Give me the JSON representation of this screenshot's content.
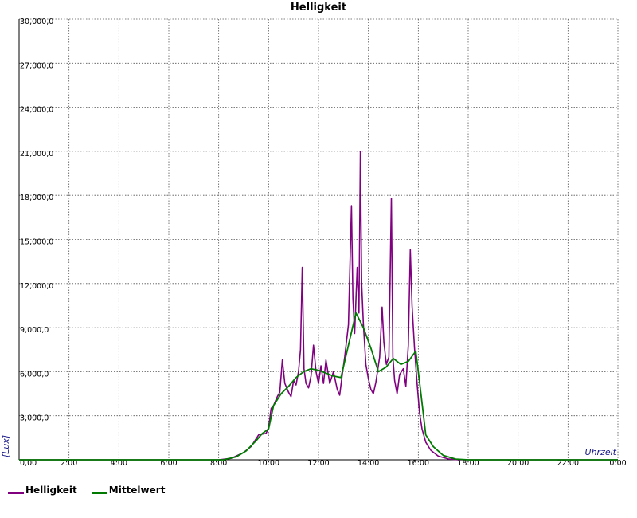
{
  "chart_data": {
    "type": "line",
    "title": "Helligkeit",
    "xlabel": "Uhrzeit",
    "ylabel": "[Lux]",
    "xlim": [
      0,
      24
    ],
    "ylim": [
      0,
      30000
    ],
    "x_ticks": [
      0,
      2,
      4,
      6,
      8,
      10,
      12,
      14,
      16,
      18,
      20,
      22,
      24
    ],
    "x_tick_labels": [
      "0,00",
      "2:00",
      "4:00",
      "6:00",
      "8:00",
      "10:00",
      "12:00",
      "14:00",
      "16:00",
      "18:00",
      "20:00",
      "22:00",
      "0:00"
    ],
    "y_ticks": [
      0,
      3000,
      6000,
      9000,
      12000,
      15000,
      18000,
      21000,
      24000,
      27000,
      30000
    ],
    "y_tick_labels": [
      "",
      "3,000,0",
      "6,000,0",
      "9,000,0",
      "12,000,0",
      "15,000,0",
      "18,000,0",
      "21,000,0",
      "24,000,0",
      "27,000,0",
      "30,000,0"
    ],
    "grid": true,
    "legend_position": "bottom-left",
    "series": [
      {
        "name": "Helligkeit",
        "color": "#800080",
        "points": [
          [
            0,
            0
          ],
          [
            8.0,
            0
          ],
          [
            8.5,
            100
          ],
          [
            9.0,
            500
          ],
          [
            9.3,
            900
          ],
          [
            9.6,
            1700
          ],
          [
            9.9,
            1800
          ],
          [
            10.0,
            2200
          ],
          [
            10.1,
            3500
          ],
          [
            10.2,
            3700
          ],
          [
            10.35,
            4300
          ],
          [
            10.45,
            4600
          ],
          [
            10.55,
            6800
          ],
          [
            10.65,
            5200
          ],
          [
            10.8,
            4600
          ],
          [
            10.9,
            4300
          ],
          [
            11.0,
            5400
          ],
          [
            11.1,
            5100
          ],
          [
            11.2,
            6000
          ],
          [
            11.28,
            7500
          ],
          [
            11.35,
            13100
          ],
          [
            11.42,
            6200
          ],
          [
            11.5,
            5200
          ],
          [
            11.6,
            4900
          ],
          [
            11.7,
            5700
          ],
          [
            11.8,
            7800
          ],
          [
            11.9,
            6000
          ],
          [
            12.0,
            5200
          ],
          [
            12.1,
            6400
          ],
          [
            12.2,
            5200
          ],
          [
            12.3,
            6800
          ],
          [
            12.45,
            5200
          ],
          [
            12.6,
            6000
          ],
          [
            12.75,
            4800
          ],
          [
            12.85,
            4400
          ],
          [
            12.95,
            5800
          ],
          [
            13.05,
            7000
          ],
          [
            13.2,
            9200
          ],
          [
            13.32,
            17300
          ],
          [
            13.38,
            11000
          ],
          [
            13.45,
            8600
          ],
          [
            13.55,
            13100
          ],
          [
            13.62,
            10000
          ],
          [
            13.68,
            21000
          ],
          [
            13.73,
            12000
          ],
          [
            13.8,
            9200
          ],
          [
            13.9,
            6500
          ],
          [
            14.0,
            5500
          ],
          [
            14.1,
            4800
          ],
          [
            14.2,
            4500
          ],
          [
            14.3,
            5300
          ],
          [
            14.45,
            7000
          ],
          [
            14.55,
            10400
          ],
          [
            14.62,
            8000
          ],
          [
            14.72,
            6500
          ],
          [
            14.82,
            7000
          ],
          [
            14.92,
            17800
          ],
          [
            14.98,
            7000
          ],
          [
            15.05,
            5400
          ],
          [
            15.15,
            4500
          ],
          [
            15.25,
            5800
          ],
          [
            15.4,
            6200
          ],
          [
            15.5,
            5000
          ],
          [
            15.6,
            7800
          ],
          [
            15.68,
            14300
          ],
          [
            15.75,
            10500
          ],
          [
            15.85,
            7600
          ],
          [
            15.95,
            5200
          ],
          [
            16.05,
            3200
          ],
          [
            16.15,
            2100
          ],
          [
            16.3,
            1200
          ],
          [
            16.5,
            650
          ],
          [
            16.8,
            250
          ],
          [
            17.2,
            60
          ],
          [
            17.6,
            0
          ],
          [
            24,
            0
          ]
        ]
      },
      {
        "name": "Mittelwert",
        "color": "#007a00",
        "points": [
          [
            0,
            0
          ],
          [
            8.2,
            0
          ],
          [
            8.7,
            200
          ],
          [
            9.1,
            600
          ],
          [
            9.5,
            1300
          ],
          [
            9.75,
            1800
          ],
          [
            10.0,
            2100
          ],
          [
            10.2,
            3700
          ],
          [
            10.5,
            4500
          ],
          [
            10.8,
            5000
          ],
          [
            11.1,
            5600
          ],
          [
            11.4,
            6000
          ],
          [
            11.7,
            6200
          ],
          [
            12.0,
            6100
          ],
          [
            12.3,
            5900
          ],
          [
            12.6,
            5700
          ],
          [
            12.9,
            5600
          ],
          [
            13.2,
            7800
          ],
          [
            13.5,
            10000
          ],
          [
            13.8,
            9000
          ],
          [
            14.1,
            7600
          ],
          [
            14.4,
            6000
          ],
          [
            14.7,
            6300
          ],
          [
            15.0,
            6900
          ],
          [
            15.3,
            6500
          ],
          [
            15.6,
            6700
          ],
          [
            15.9,
            7400
          ],
          [
            16.05,
            5300
          ],
          [
            16.3,
            1700
          ],
          [
            16.6,
            900
          ],
          [
            17.0,
            300
          ],
          [
            17.5,
            50
          ],
          [
            18.0,
            0
          ],
          [
            24,
            0
          ]
        ]
      }
    ]
  }
}
